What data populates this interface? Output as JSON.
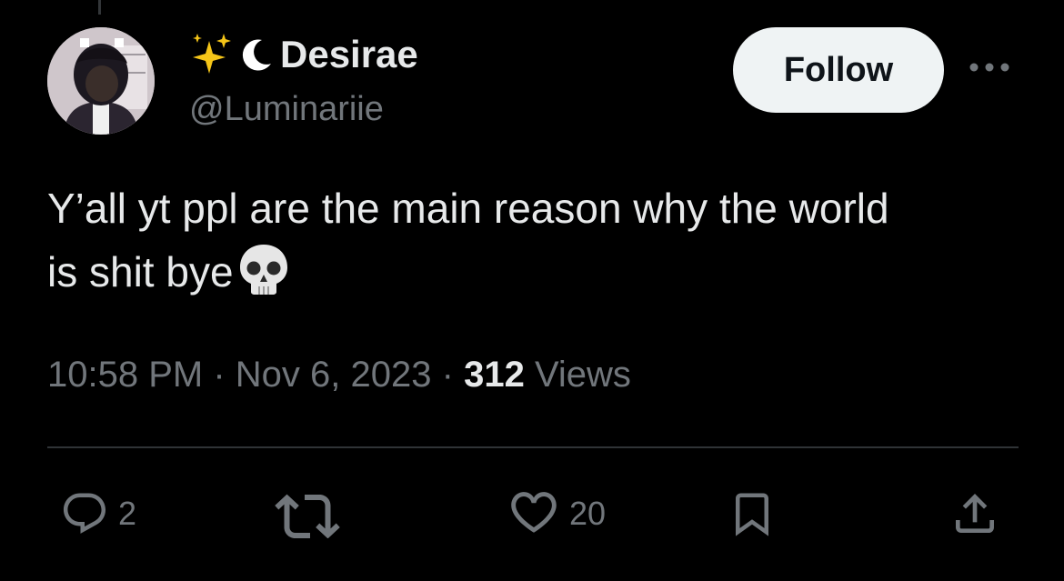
{
  "post": {
    "display_name": "Desirae",
    "handle": "@Luminariie",
    "follow_label": "Follow",
    "text_line1": "Y’all yt ppl are the main reason why the world",
    "text_line2": "is shit bye",
    "time": "10:58 PM",
    "date": "Nov 6, 2023",
    "separator": "·",
    "views_count": "312",
    "views_label": "Views"
  },
  "actions": {
    "replies": "2",
    "reposts": "",
    "likes": "20"
  },
  "icons": {
    "name_emoji_1": "sparkles-icon",
    "name_emoji_2": "crescent-moon-icon",
    "text_emoji": "skull-icon",
    "more": "more-icon",
    "reply": "reply-icon",
    "repost": "repost-icon",
    "like": "like-icon",
    "bookmark": "bookmark-icon",
    "share": "share-icon"
  },
  "colors": {
    "background": "#000000",
    "text": "#e7e9ea",
    "secondary": "#71767b",
    "follow_bg": "#eff3f4",
    "sparkle": "#f5c518"
  }
}
